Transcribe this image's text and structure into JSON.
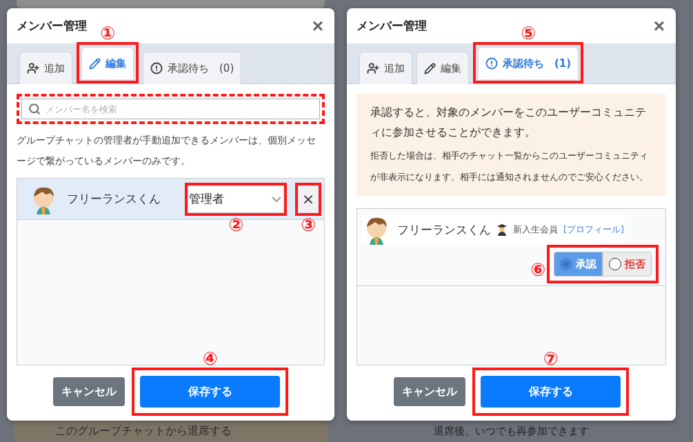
{
  "backdrop": {
    "leave_button": "このグループチャットから退席する",
    "leave_note": "退席後、いつでも再参加できます"
  },
  "dialogs": [
    {
      "kind": "edit",
      "title": "メンバー管理",
      "close": "×",
      "tabs": [
        {
          "label": "追加",
          "selected": false
        },
        {
          "label": "編集",
          "selected": true,
          "marker": "①"
        },
        {
          "label": "承認待ち",
          "count": "(0)",
          "selected": false
        }
      ],
      "search": {
        "placeholder": "メンバー名を検索",
        "highlighted": true
      },
      "note": "グループチャットの管理者が手動追加できるメンバーは、個別メッセージで繋がっているメンバーのみです。",
      "members": [
        {
          "name": "フリーランスくん",
          "role": {
            "value": "管理者",
            "marker": "②"
          },
          "remove": {
            "label": "×",
            "marker": "③"
          }
        }
      ],
      "buttons": {
        "cancel": {
          "label": "キャンセル"
        },
        "save": {
          "label": "保存する",
          "marker": "④"
        }
      }
    },
    {
      "kind": "approval",
      "title": "メンバー管理",
      "close": "×",
      "tabs": [
        {
          "label": "追加",
          "selected": false
        },
        {
          "label": "編集",
          "selected": false
        },
        {
          "label": "承認待ち",
          "count": "(1)",
          "selected": true,
          "marker": "⑤"
        }
      ],
      "notice": {
        "main": "承認すると、対象のメンバーをこのユーザーコミュニティに参加させることができます。",
        "sub": "拒否した場合は、相手のチャット一覧からこのユーザーコミュニティが非表示になります。相手には通知されませんのでご安心ください。"
      },
      "members": [
        {
          "name": "フリーランスくん",
          "badge": "新入生会員",
          "profile_link": "[プロフィール]",
          "decision": {
            "marker": "⑥",
            "options": [
              {
                "label": "承認",
                "kind": "approve",
                "selected": true
              },
              {
                "label": "拒否",
                "kind": "reject",
                "selected": false
              }
            ]
          }
        }
      ],
      "buttons": {
        "cancel": {
          "label": "キャンセル"
        },
        "save": {
          "label": "保存する",
          "marker": "⑦"
        }
      }
    }
  ]
}
